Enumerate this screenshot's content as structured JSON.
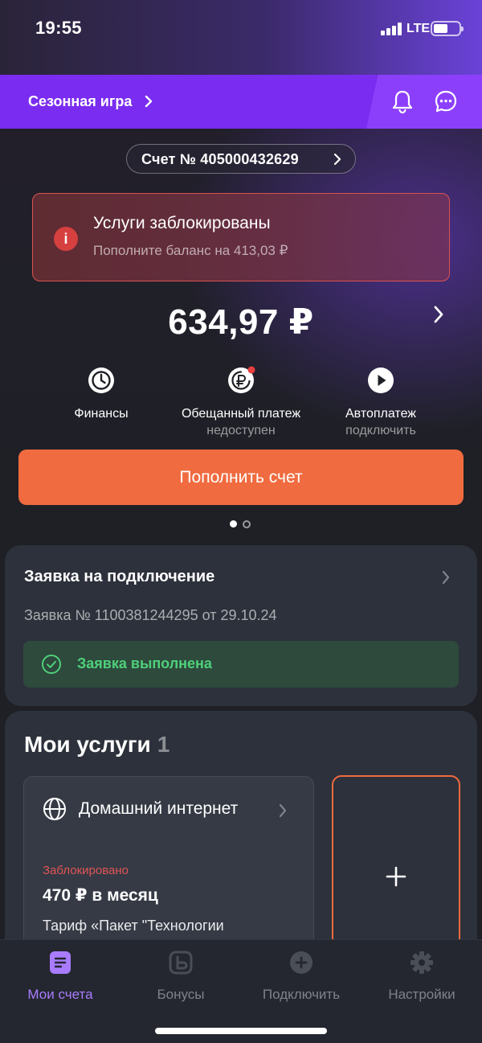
{
  "status_bar": {
    "time": "19:55",
    "network": "LTE",
    "battery_level": 0.55
  },
  "promo": {
    "label": "Сезонная игра",
    "icons": [
      "chevron-right-icon",
      "bell-icon",
      "chat-icon"
    ]
  },
  "account": {
    "label": "Счет № 405000432629"
  },
  "alert": {
    "title": "Услуги заблокированы",
    "subtitle": "Пополните баланс на 413,03 ₽",
    "icon": "info-icon",
    "color": "#d6403f"
  },
  "balance": {
    "amount": "634,97 ₽"
  },
  "quick_actions": [
    {
      "label": "Финансы",
      "sub": "",
      "icon": "finance-icon"
    },
    {
      "label": "Обещанный платеж",
      "sub": "недоступен",
      "icon": "promised-payment-icon"
    },
    {
      "label": "Автоплатеж",
      "sub": "подключить",
      "icon": "play-icon"
    }
  ],
  "topup": {
    "label": "Пополнить счет",
    "color": "#f06b3f"
  },
  "pager": {
    "pages": 2,
    "current": 1
  },
  "request": {
    "title": "Заявка на подключение",
    "number": "Заявка № 1100381244295 от 29.10.24",
    "status": "Заявка выполнена",
    "status_color": "#4fd07a"
  },
  "services": {
    "title": "Мои услуги",
    "count": "1",
    "items": [
      {
        "name": "Домашний интернет",
        "status": "Заблокировано",
        "price": "470 ₽ в месяц",
        "tariff": "Тариф «Пакет \"Технологии",
        "icon": "globe-icon"
      }
    ],
    "add_icon": "plus-icon"
  },
  "nav": {
    "items": [
      {
        "label": "Мои счета",
        "icon": "accounts-icon",
        "active": true
      },
      {
        "label": "Бонусы",
        "icon": "bonus-icon",
        "active": false
      },
      {
        "label": "Подключить",
        "icon": "plus-circle-icon",
        "active": false
      },
      {
        "label": "Настройки",
        "icon": "gear-icon",
        "active": false
      }
    ],
    "active_color": "#a97cff"
  }
}
